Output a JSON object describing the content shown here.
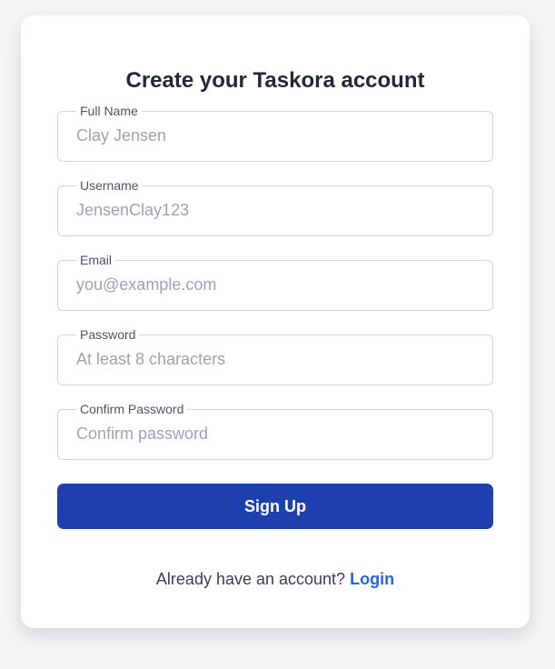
{
  "title": "Create your Taskora account",
  "fields": [
    {
      "label": "Full Name",
      "placeholder": "Clay Jensen"
    },
    {
      "label": "Username",
      "placeholder": "JensenClay123"
    },
    {
      "label": "Email",
      "placeholder": "you@example.com"
    },
    {
      "label": "Password",
      "placeholder": "At least 8 characters"
    },
    {
      "label": "Confirm Password",
      "placeholder": "Confirm password"
    }
  ],
  "submit_label": "Sign Up",
  "footer": {
    "text": "Already have an account?",
    "link": "Login"
  },
  "colors": {
    "primary": "#1e40af",
    "link": "#2563eb"
  }
}
